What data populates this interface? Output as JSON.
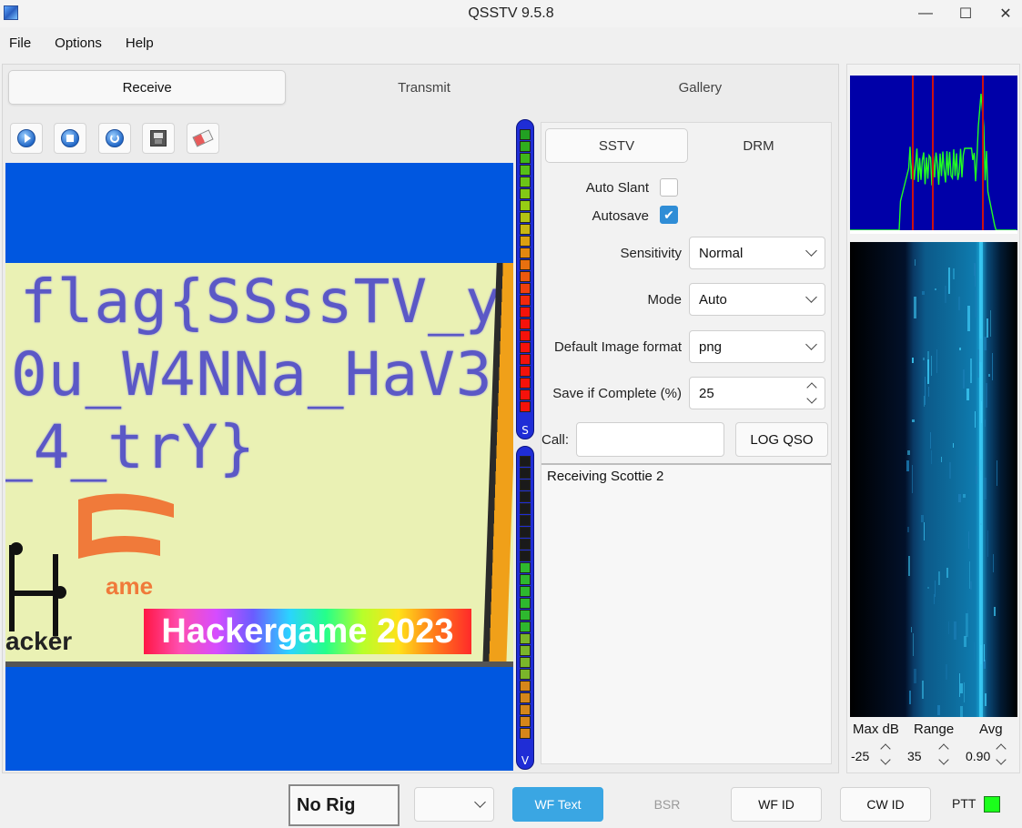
{
  "window": {
    "title": "QSSTV 9.5.8",
    "controls": {
      "minimize": "—",
      "maximize": "☐",
      "close": "✕"
    }
  },
  "menu": [
    "File",
    "Options",
    "Help"
  ],
  "main_tabs": [
    "Receive",
    "Transmit",
    "Gallery"
  ],
  "toolbar_icons": [
    "start-icon",
    "stop-icon",
    "resync-icon",
    "save-icon",
    "erase-icon"
  ],
  "image": {
    "flag_lines": [
      "flag{SSssTV_y",
      "0u_W4NNa_HaV3",
      "_4_trY}"
    ],
    "logo_game": "ame",
    "logo_hacker": "acker",
    "banner": "Hackergame 2023"
  },
  "meters": {
    "signal_letter": "S",
    "volume_letter": "V"
  },
  "mode_tabs": [
    "SSTV",
    "DRM"
  ],
  "settings": {
    "auto_slant_label": "Auto Slant",
    "auto_slant_checked": false,
    "autosave_label": "Autosave",
    "autosave_checked": true,
    "sensitivity_label": "Sensitivity",
    "sensitivity_value": "Normal",
    "mode_label": "Mode",
    "mode_value": "Auto",
    "image_format_label": "Default Image format",
    "image_format_value": "png",
    "save_complete_label": "Save if Complete (%)",
    "save_complete_value": "25",
    "call_label": "Call:",
    "call_value": "",
    "log_qso_label": "LOG QSO"
  },
  "status_message": "Receiving Scottie 2",
  "waterfall_controls": {
    "max_db_label": "Max dB",
    "range_label": "Range",
    "avg_label": "Avg",
    "max_db_value": "-25",
    "range_value": "35",
    "avg_value": "0.90"
  },
  "bottom_bar": {
    "rig": "No Rig",
    "rig_select_value": "",
    "wf_text": "WF Text",
    "bsr": "BSR",
    "wf_id": "WF ID",
    "cw_id": "CW ID",
    "ptt": "PTT"
  },
  "colors": {
    "accent": "#3aa6e3",
    "image_background": "#0057e0",
    "spectrum_background": "#0000a8",
    "spectrum_trace": "#22ff22",
    "marker": "#cc1111",
    "ptt_led": "#1bff1b"
  }
}
